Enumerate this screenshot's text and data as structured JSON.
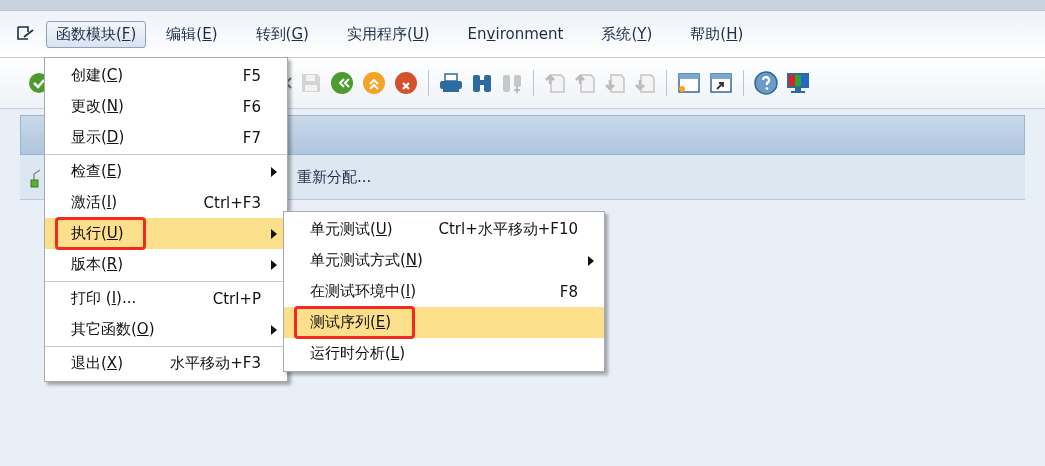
{
  "menu_bar": [
    {
      "before": "函数模块(",
      "key": "F",
      "after": ")",
      "selected": true
    },
    {
      "before": "编辑(",
      "key": "E",
      "after": ")",
      "selected": false
    },
    {
      "before": "转到(",
      "key": "G",
      "after": ")",
      "selected": false
    },
    {
      "before": "实用程序(",
      "key": "U",
      "after": ")",
      "selected": false
    },
    {
      "before": "En",
      "key": "v",
      "after": "ironment",
      "selected": false
    },
    {
      "before": "系统(",
      "key": "Y",
      "after": ")",
      "selected": false
    },
    {
      "before": "帮助(",
      "key": "H",
      "after": ")",
      "selected": false
    }
  ],
  "toolbar": [
    {
      "kind": "check"
    },
    {
      "kind": "back-arrows"
    },
    {
      "kind": "save"
    },
    {
      "kind": "green-back"
    },
    {
      "kind": "orange-up"
    },
    {
      "kind": "red-cancel"
    },
    {
      "kind": "sep"
    },
    {
      "kind": "print"
    },
    {
      "kind": "find"
    },
    {
      "kind": "find-next"
    },
    {
      "kind": "sep"
    },
    {
      "kind": "page-first"
    },
    {
      "kind": "page-up"
    },
    {
      "kind": "page-down"
    },
    {
      "kind": "page-last"
    },
    {
      "kind": "sep"
    },
    {
      "kind": "new-window"
    },
    {
      "kind": "shortcut"
    },
    {
      "kind": "sep"
    },
    {
      "kind": "help"
    },
    {
      "kind": "monitor"
    }
  ],
  "sub_toolbar": {
    "button": "重新分配..."
  },
  "dropdown": [
    {
      "kind": "item",
      "before": "创建(",
      "key": "C",
      "after": ")",
      "shortcut": "F5",
      "submenu": false,
      "selected": false,
      "annotated": false
    },
    {
      "kind": "item",
      "before": "更改(",
      "key": "N",
      "after": ")",
      "shortcut": "F6",
      "submenu": false,
      "selected": false,
      "annotated": false
    },
    {
      "kind": "item",
      "before": "显示(",
      "key": "D",
      "after": ")",
      "shortcut": "F7",
      "submenu": false,
      "selected": false,
      "annotated": false
    },
    {
      "kind": "separator"
    },
    {
      "kind": "item",
      "before": "检查(",
      "key": "E",
      "after": ")",
      "submenu": true,
      "selected": false,
      "annotated": false
    },
    {
      "kind": "item",
      "before": "激活(",
      "key": "I",
      "after": ")",
      "shortcut": "Ctrl+F3",
      "submenu": false,
      "selected": false,
      "annotated": false
    },
    {
      "kind": "item",
      "before": "执行(",
      "key": "U",
      "after": ")",
      "submenu": true,
      "selected": true,
      "annotated": true
    },
    {
      "kind": "item",
      "before": "版本(",
      "key": "R",
      "after": ")",
      "submenu": true,
      "selected": false,
      "annotated": false
    },
    {
      "kind": "separator"
    },
    {
      "kind": "item",
      "before": "打印 (",
      "key": "I",
      "after": ")...",
      "shortcut": "Ctrl+P",
      "submenu": false,
      "selected": false,
      "annotated": false
    },
    {
      "kind": "item",
      "before": "其它函数(",
      "key": "O",
      "after": ")",
      "submenu": true,
      "selected": false,
      "annotated": false
    },
    {
      "kind": "separator"
    },
    {
      "kind": "item",
      "before": "退出(",
      "key": "X",
      "after": ")",
      "shortcut": "水平移动+F3",
      "submenu": false,
      "selected": false,
      "annotated": false
    }
  ],
  "submenu": [
    {
      "kind": "item",
      "before": "单元测试(",
      "key": "U",
      "after": ")",
      "shortcut": "Ctrl+水平移动+F10",
      "submenu": false,
      "selected": false,
      "annotated": false
    },
    {
      "kind": "item",
      "before": "单元测试方式(",
      "key": "N",
      "after": ")",
      "submenu": true,
      "selected": false,
      "annotated": false
    },
    {
      "kind": "item",
      "before": "在测试环境中(",
      "key": "I",
      "after": ")",
      "shortcut": "F8",
      "submenu": false,
      "selected": false,
      "annotated": false
    },
    {
      "kind": "item",
      "before": "测试序列(",
      "key": "E",
      "after": ")",
      "submenu": false,
      "selected": true,
      "annotated": true
    },
    {
      "kind": "item",
      "before": "运行时分析(",
      "key": "L",
      "after": ")",
      "submenu": false,
      "selected": false,
      "annotated": false
    }
  ]
}
